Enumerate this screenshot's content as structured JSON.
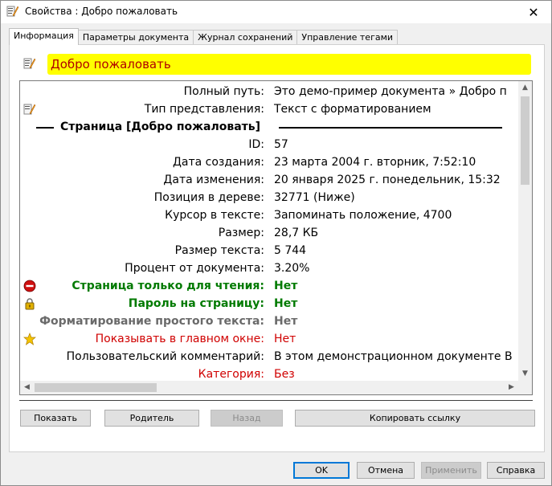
{
  "window": {
    "title": "Свойства : Добро пожаловать",
    "close_icon": "close-icon"
  },
  "tabs": [
    {
      "label": "Информация",
      "active": true
    },
    {
      "label": "Параметры документа",
      "active": false
    },
    {
      "label": "Журнал сохранений",
      "active": false
    },
    {
      "label": "Управление тегами",
      "active": false
    }
  ],
  "header": {
    "title": "Добро пожаловать",
    "highlight_color": "#ffff00",
    "title_color": "#b00000"
  },
  "info": {
    "full_path_label": "Полный путь:",
    "full_path_value": "Это демо-пример документа » Добро п",
    "view_type_label": "Тип представления:",
    "view_type_value": "Текст с форматированием",
    "section_title": "Страница [Добро пожаловать]",
    "id_label": "ID:",
    "id_value": "57",
    "created_label": "Дата создания:",
    "created_value": "23 марта 2004 г. вторник, 7:52:10",
    "modified_label": "Дата изменения:",
    "modified_value": "20 января 2025 г. понедельник, 15:32",
    "tree_pos_label": "Позиция в дереве:",
    "tree_pos_value": "32771 (Ниже)",
    "cursor_label": "Курсор в тексте:",
    "cursor_value": "Запоминать положение, 4700",
    "size_label": "Размер:",
    "size_value": "28,7 КБ",
    "text_size_label": "Размер текста:",
    "text_size_value": "5 744",
    "percent_label": "Процент от документа:",
    "percent_value": "3.20%",
    "readonly_label": "Страница только для чтения:",
    "readonly_value": "Нет",
    "password_label": "Пароль на страницу:",
    "password_value": "Нет",
    "plain_format_label": "Форматирование простого текста:",
    "plain_format_value": "Нет",
    "show_main_label": "Показывать в главном окне:",
    "show_main_value": "Нет",
    "comment_label": "Пользовательский комментарий:",
    "comment_value": "В этом демонстрационном документе В",
    "category_label": "Категория:",
    "category_value": "Без"
  },
  "panel_buttons": {
    "show": "Показать",
    "parent": "Родитель",
    "back": "Назад",
    "copy_link": "Копировать ссылку"
  },
  "dialog_buttons": {
    "ok": "OK",
    "cancel": "Отмена",
    "apply": "Применить",
    "help": "Справка"
  },
  "colors": {
    "green": "#007a00",
    "red": "#d00000",
    "gray": "#6a6a6a",
    "accent": "#0078d7"
  }
}
